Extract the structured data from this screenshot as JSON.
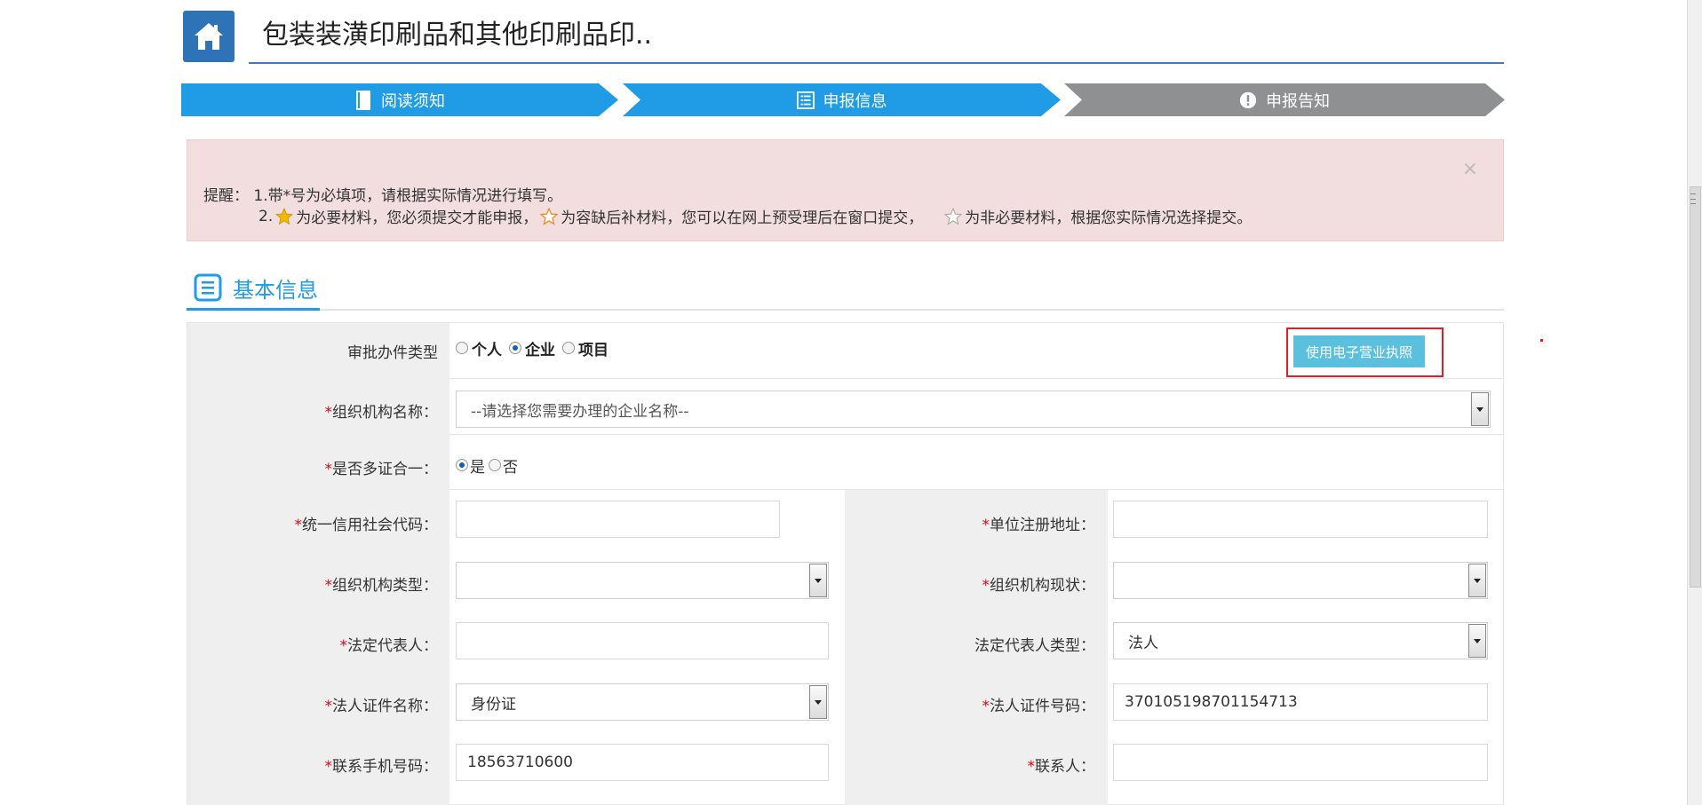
{
  "header": {
    "title": "包装装潢印刷品和其他印刷品印.."
  },
  "steps": [
    {
      "label": "阅读须知",
      "icon": "book-icon"
    },
    {
      "label": "申报信息",
      "icon": "list-icon"
    },
    {
      "label": "申报告知",
      "icon": "exclamation-icon"
    }
  ],
  "reminder": {
    "prefix": "提醒：",
    "line1": "1.带*号为必填项，请根据实际情况进行填写。",
    "line2_prefix": "2.",
    "line2_part1": "为必要材料，您必须提交才能申报，",
    "line2_part2": "为容缺后补材料，您可以在网上预受理后在窗口提交，",
    "line2_part3": "为非必要材料，根据您实际情况选择提交。",
    "close": "×"
  },
  "section": {
    "title": "基本信息"
  },
  "form": {
    "type_label": "审批办件类型",
    "type_options": [
      "个人",
      "企业",
      "项目"
    ],
    "type_selected": "企业",
    "license_button": "使用电子营业执照",
    "org_name_label": "组织机构名称：",
    "org_name_placeholder": "--请选择您需要办理的企业名称--",
    "multi_cert_label": "是否多证合一：",
    "multi_cert_options": [
      "是",
      "否"
    ],
    "multi_cert_selected": "是",
    "credit_code_label": "统一信用社会代码：",
    "credit_code_value": "",
    "reg_address_label": "单位注册地址：",
    "reg_address_value": "",
    "org_type_label": "组织机构类型：",
    "org_type_value": "",
    "org_status_label": "组织机构现状：",
    "org_status_value": "",
    "legal_rep_label": "法定代表人：",
    "legal_rep_value": "",
    "legal_rep_type_label": "法定代表人类型：",
    "legal_rep_type_value": "法人",
    "id_name_label": "法人证件名称：",
    "id_name_value": "身份证",
    "id_number_label": "法人证件号码：",
    "id_number_value": "370105198701154713",
    "phone_label": "联系手机号码：",
    "phone_value": "18563710600",
    "contact_label": "联系人：",
    "contact_value": "",
    "required_mark": "*"
  },
  "colors": {
    "accent": "#1f9ce5",
    "inactive_step": "#8f9092",
    "alert_bg": "#f2dede",
    "highlight": "#e51c23"
  }
}
